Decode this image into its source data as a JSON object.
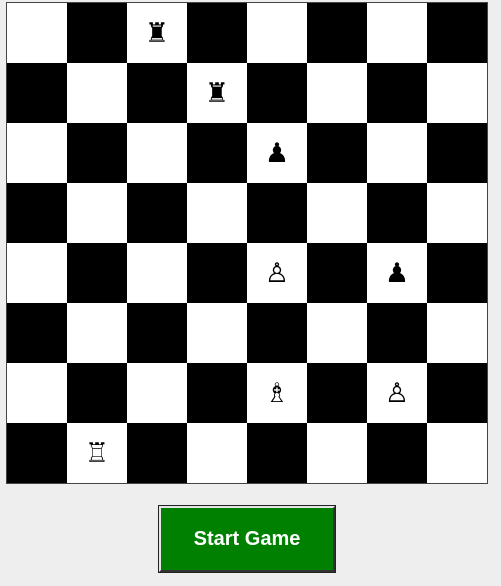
{
  "board": {
    "light_color": "#ffffff",
    "dark_color": "#000000",
    "first_square_dark": false,
    "ranks": [
      [
        "",
        "",
        "black-rook",
        "",
        "",
        "",
        "",
        ""
      ],
      [
        "",
        "",
        "",
        "black-rook",
        "",
        "",
        "",
        ""
      ],
      [
        "",
        "",
        "",
        "",
        "black-pawn",
        "",
        "",
        ""
      ],
      [
        "",
        "",
        "",
        "",
        "",
        "",
        "",
        ""
      ],
      [
        "",
        "",
        "",
        "",
        "white-pawn",
        "",
        "black-pawn",
        ""
      ],
      [
        "",
        "",
        "",
        "",
        "",
        "",
        "",
        ""
      ],
      [
        "",
        "",
        "",
        "",
        "white-bishop",
        "",
        "white-pawn",
        ""
      ],
      [
        "",
        "white-rook",
        "",
        "",
        "",
        "",
        "",
        ""
      ]
    ]
  },
  "piece_glyphs": {
    "black-rook": "♜",
    "black-pawn": "♟",
    "white-rook": "♖",
    "white-pawn": "♙",
    "white-bishop": "♗"
  },
  "controls": {
    "start_label": "Start Game",
    "start_color": "#008000"
  }
}
